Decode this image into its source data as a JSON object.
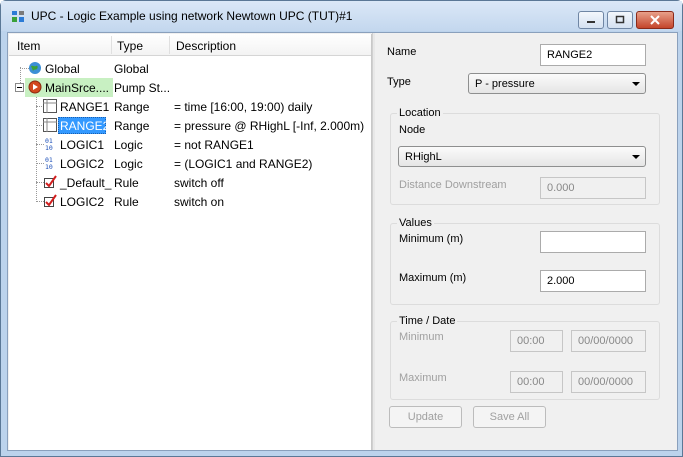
{
  "window": {
    "title": "UPC - Logic Example using network Newtown UPC (TUT)#1"
  },
  "tree": {
    "columns": [
      "Item",
      "Type",
      "Description"
    ],
    "rows": [
      {
        "item": "Global",
        "type": "Global",
        "desc": "",
        "icon": "globe-icon"
      },
      {
        "item": "MainSrce....",
        "type": "Pump St...",
        "desc": "",
        "icon": "play-icon"
      },
      {
        "item": "RANGE1",
        "type": "Range",
        "desc": "= time [16:00, 19:00) daily",
        "icon": "range-icon"
      },
      {
        "item": "RANGE2",
        "type": "Range",
        "desc": "= pressure @ RHighL [-Inf, 2.000m)",
        "icon": "range-icon"
      },
      {
        "item": "LOGIC1",
        "type": "Logic",
        "desc": "= not RANGE1",
        "icon": "logic-icon"
      },
      {
        "item": "LOGIC2",
        "type": "Logic",
        "desc": "= (LOGIC1 and RANGE2)",
        "icon": "logic-icon"
      },
      {
        "item": "_Default_",
        "type": "Rule",
        "desc": "switch off",
        "icon": "rule-check-icon"
      },
      {
        "item": "LOGIC2",
        "type": "Rule",
        "desc": "switch on",
        "icon": "rule-check-icon"
      }
    ]
  },
  "form": {
    "name_label": "Name",
    "name_value": "RANGE2",
    "type_label": "Type",
    "type_value": "P - pressure",
    "location_title": "Location",
    "node_label": "Node",
    "node_value": "RHighL",
    "distance_label": "Distance Downstream",
    "distance_value": "0.000",
    "values_title": "Values",
    "min_label": "Minimum (m)",
    "min_value": "",
    "max_label": "Maximum (m)",
    "max_value": "2.000",
    "timedate_title": "Time / Date",
    "td_min_label": "Minimum",
    "td_min_time": "00:00",
    "td_min_date": "00/00/0000",
    "td_max_label": "Maximum",
    "td_max_time": "00:00",
    "td_max_date": "00/00/0000",
    "update_label": "Update",
    "saveall_label": "Save All"
  }
}
